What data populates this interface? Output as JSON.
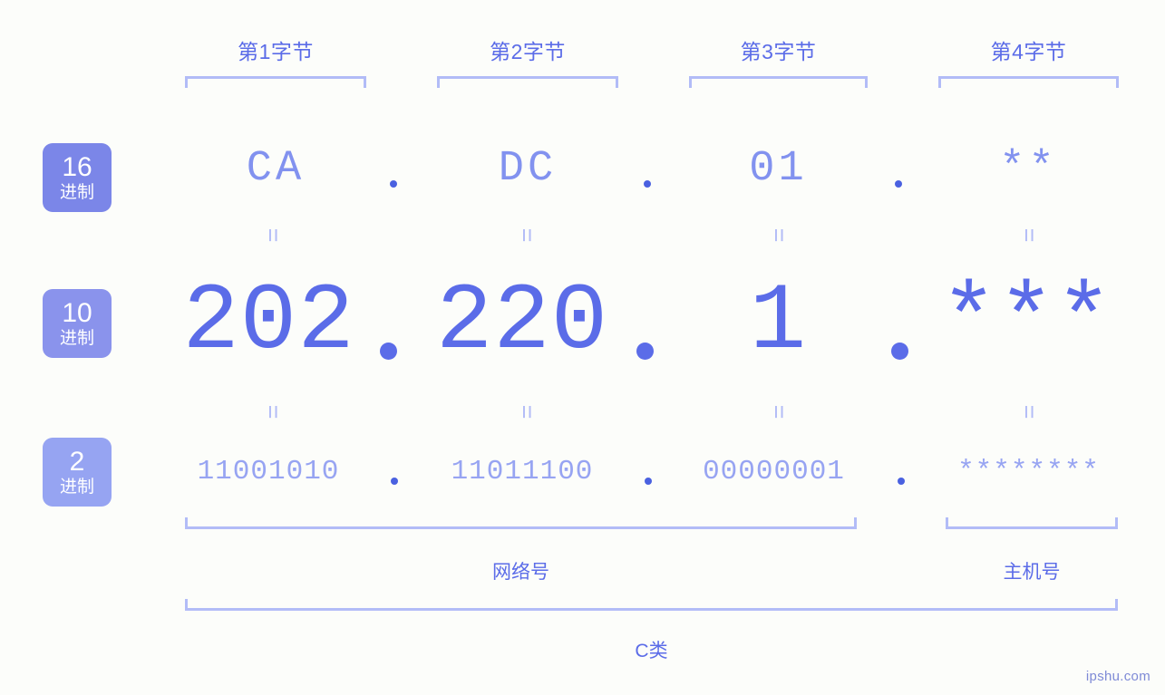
{
  "bytes": [
    {
      "header": "第1字节"
    },
    {
      "header": "第2字节"
    },
    {
      "header": "第3字节"
    },
    {
      "header": "第4字节"
    }
  ],
  "bases": [
    {
      "number": "16",
      "word": "进制",
      "color": "#7b86e8"
    },
    {
      "number": "10",
      "word": "进制",
      "color": "#8a93ec"
    },
    {
      "number": "2",
      "word": "进制",
      "color": "#96a4f2"
    }
  ],
  "rows": {
    "hex": {
      "values": [
        "CA",
        "DC",
        "01",
        "**"
      ]
    },
    "dec": {
      "values": [
        "202",
        "220",
        "1",
        "***"
      ]
    },
    "bin": {
      "values": [
        "11001010",
        "11011100",
        "00000001",
        "********"
      ]
    }
  },
  "separators": {
    "equals": "=",
    "dot": "."
  },
  "regions": [
    {
      "label": "网络号"
    },
    {
      "label": "主机号"
    }
  ],
  "class": {
    "label": "C类"
  },
  "watermark": {
    "text": "ipshu.com"
  },
  "colors": {
    "background": "#fcfdfa",
    "accent": "#5b6ce8",
    "accent_light": "#b2bcf7",
    "hex_text": "#8292ef",
    "bin_text": "#97a4f2"
  }
}
